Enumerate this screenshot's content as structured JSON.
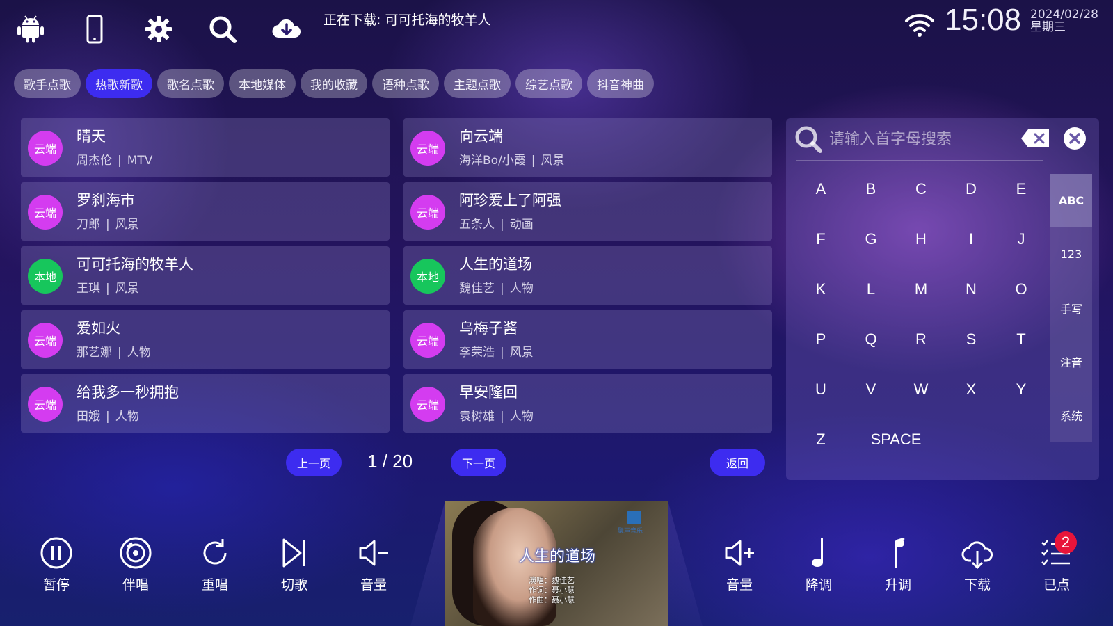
{
  "status": {
    "download_text": "正在下载: 可可托海的牧羊人",
    "time": "15:08",
    "date": "2024/02/28",
    "weekday": "星期三"
  },
  "top_icons": [
    "android-icon",
    "phone-icon",
    "gear-icon",
    "search-icon",
    "cloud-download-icon"
  ],
  "tabs": [
    {
      "label": "歌手点歌"
    },
    {
      "label": "热歌新歌",
      "active": true
    },
    {
      "label": "歌名点歌"
    },
    {
      "label": "本地媒体"
    },
    {
      "label": "我的收藏"
    },
    {
      "label": "语种点歌"
    },
    {
      "label": "主题点歌"
    },
    {
      "label": "综艺点歌"
    },
    {
      "label": "抖音神曲"
    }
  ],
  "songs": [
    {
      "badge": "云端",
      "type": "cloud",
      "title": "晴天",
      "artist": "周杰伦",
      "category": "MTV"
    },
    {
      "badge": "云端",
      "type": "cloud",
      "title": "向云端",
      "artist": "海洋Bo/小霞",
      "category": "风景"
    },
    {
      "badge": "云端",
      "type": "cloud",
      "title": "罗刹海市",
      "artist": "刀郎",
      "category": "风景"
    },
    {
      "badge": "云端",
      "type": "cloud",
      "title": "阿珍爱上了阿强",
      "artist": "五条人",
      "category": "动画"
    },
    {
      "badge": "本地",
      "type": "local",
      "title": "可可托海的牧羊人",
      "artist": "王琪",
      "category": "风景"
    },
    {
      "badge": "本地",
      "type": "local",
      "title": "人生的道场",
      "artist": "魏佳艺",
      "category": "人物"
    },
    {
      "badge": "云端",
      "type": "cloud",
      "title": "爱如火",
      "artist": "那艺娜",
      "category": "人物"
    },
    {
      "badge": "云端",
      "type": "cloud",
      "title": "乌梅子酱",
      "artist": "李荣浩",
      "category": "风景"
    },
    {
      "badge": "云端",
      "type": "cloud",
      "title": "给我多一秒拥抱",
      "artist": "田娥",
      "category": "人物"
    },
    {
      "badge": "云端",
      "type": "cloud",
      "title": "早安隆回",
      "artist": "袁树雄",
      "category": "人物"
    }
  ],
  "pager": {
    "prev": "上一页",
    "page": "1 / 20",
    "next": "下一页",
    "back": "返回"
  },
  "keyboard": {
    "placeholder": "请输入首字母搜索",
    "keys": [
      "A",
      "B",
      "C",
      "D",
      "E",
      "F",
      "G",
      "H",
      "I",
      "J",
      "K",
      "L",
      "M",
      "N",
      "O",
      "P",
      "Q",
      "R",
      "S",
      "T",
      "U",
      "V",
      "W",
      "X",
      "Y",
      "Z",
      "SPACE"
    ],
    "modes": [
      {
        "label": "ABC",
        "active": true
      },
      {
        "label": "123"
      },
      {
        "label": "手写"
      },
      {
        "label": "注音"
      },
      {
        "label": "系统"
      }
    ]
  },
  "controls_left": [
    {
      "label": "暂停",
      "icon": "pause-icon"
    },
    {
      "label": "伴唱",
      "icon": "accompany-icon"
    },
    {
      "label": "重唱",
      "icon": "replay-icon"
    },
    {
      "label": "切歌",
      "icon": "skip-icon"
    },
    {
      "label": "音量",
      "icon": "volume-down-icon"
    }
  ],
  "controls_right": [
    {
      "label": "音量",
      "icon": "volume-up-icon"
    },
    {
      "label": "降调",
      "icon": "pitch-down-icon"
    },
    {
      "label": "升调",
      "icon": "pitch-up-icon"
    },
    {
      "label": "下载",
      "icon": "download-icon"
    },
    {
      "label": "已点",
      "icon": "playlist-icon",
      "count": "2"
    }
  ],
  "video": {
    "title": "人生的道场",
    "credit_singer": "演唱：魏佳艺",
    "credit_lyric": "作词：聂小慧",
    "credit_music": "作曲：聂小慧",
    "logo_text": "聚声音乐"
  },
  "colors": {
    "accent": "#3d2cf0",
    "cloud_badge": "#d43cf0",
    "local_badge": "#17c65c",
    "count_badge": "#e8143a"
  }
}
